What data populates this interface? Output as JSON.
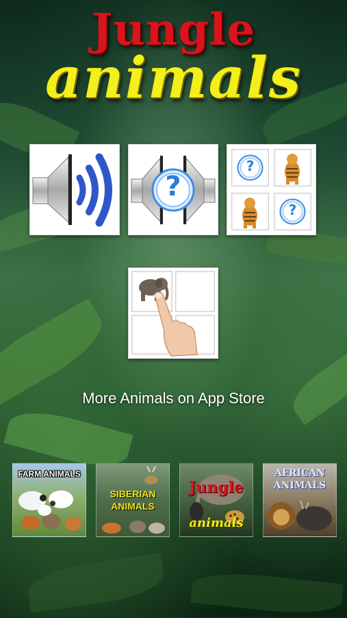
{
  "app": {
    "title_line1": "Jungle",
    "title_line2": "animals"
  },
  "menu": {
    "items": [
      {
        "name": "listen-sounds",
        "icon": "speaker-sound-icon"
      },
      {
        "name": "guess-sound",
        "icon": "speaker-question-icon"
      },
      {
        "name": "memory-game",
        "icon": "memory-cards-icon"
      },
      {
        "name": "touch-animal",
        "icon": "finger-touch-icon"
      }
    ],
    "memory_question_mark": "?",
    "quiz_question_mark": "?"
  },
  "more_apps": {
    "heading": "More Animals on App Store",
    "apps": [
      {
        "label": "FARM ANIMALS",
        "color": "#ffffff"
      },
      {
        "label_line1": "SIBERIAN",
        "label_line2": "ANIMALS",
        "color": "#f3e21e"
      },
      {
        "label_line1": "Jungle",
        "label_line2": "animals",
        "color_line1": "#d8141d",
        "color_line2": "#f2ef1a"
      },
      {
        "label_line1": "AFRICAN",
        "label_line2": "ANIMALS",
        "color": "#dfe7ff"
      }
    ]
  },
  "colors": {
    "speaker_blue": "#2f57c9",
    "title_red": "#d8141d",
    "title_yellow": "#f2ef1a"
  }
}
